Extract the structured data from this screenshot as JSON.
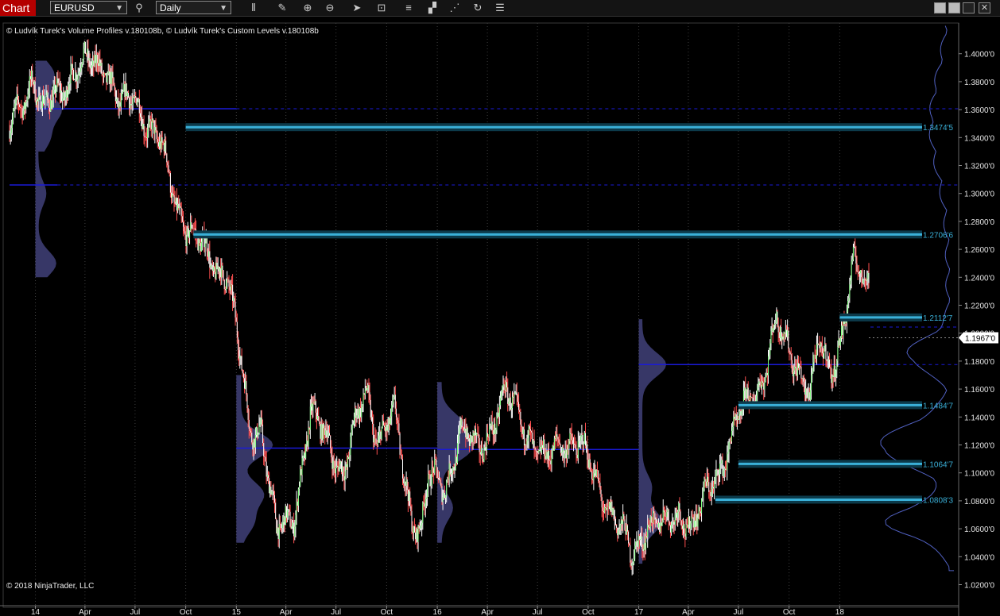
{
  "toolbar": {
    "tab_label": "Chart",
    "instrument": "EURUSD",
    "interval": "Daily"
  },
  "header": {
    "indicators_text": "© Ludvík Turek's Volume Profiles v.180108b, © Ludvík Turek's Custom Levels v.180108b"
  },
  "footer": {
    "copyright": "© 2018 NinjaTrader, LLC"
  },
  "colors": {
    "background": "#000000",
    "level_line": "#3ab0d8",
    "poc_line": "#1a1ad8",
    "profile_fill": "#4a4a8a",
    "current_price_box": "#ffffff"
  },
  "chart_data": {
    "type": "candlestick",
    "instrument": "EURUSD",
    "interval": "Daily",
    "ylim": [
      1.01,
      1.425
    ],
    "xlim": [
      "2013-11-15",
      "2018-03-05"
    ],
    "y_ticks": [
      "1.0200'0",
      "1.0400'0",
      "1.0600'0",
      "1.0800'0",
      "1.1000'0",
      "1.1200'0",
      "1.1400'0",
      "1.1600'0",
      "1.1800'0",
      "1.2000'0",
      "1.2200'0",
      "1.2400'0",
      "1.2600'0",
      "1.2800'0",
      "1.3000'0",
      "1.3200'0",
      "1.3400'0",
      "1.3600'0",
      "1.3800'0",
      "1.4000'0"
    ],
    "x_ticks": [
      {
        "label": "14",
        "date": "2014-01-01"
      },
      {
        "label": "Apr",
        "date": "2014-04-01"
      },
      {
        "label": "Jul",
        "date": "2014-07-01"
      },
      {
        "label": "Oct",
        "date": "2014-10-01"
      },
      {
        "label": "15",
        "date": "2015-01-01"
      },
      {
        "label": "Apr",
        "date": "2015-04-01"
      },
      {
        "label": "Jul",
        "date": "2015-07-01"
      },
      {
        "label": "Oct",
        "date": "2015-10-01"
      },
      {
        "label": "16",
        "date": "2016-01-01"
      },
      {
        "label": "Apr",
        "date": "2016-04-01"
      },
      {
        "label": "Jul",
        "date": "2016-07-01"
      },
      {
        "label": "Oct",
        "date": "2016-10-01"
      },
      {
        "label": "17",
        "date": "2017-01-01"
      },
      {
        "label": "Apr",
        "date": "2017-04-01"
      },
      {
        "label": "Jul",
        "date": "2017-07-01"
      },
      {
        "label": "Oct",
        "date": "2017-10-01"
      },
      {
        "label": "18",
        "date": "2018-01-01"
      }
    ],
    "price_path": [
      [
        "2013-11-15",
        1.345
      ],
      [
        "2013-12-27",
        1.385
      ],
      [
        "2014-01-15",
        1.357
      ],
      [
        "2014-03-15",
        1.39
      ],
      [
        "2014-05-08",
        1.393
      ],
      [
        "2014-06-05",
        1.36
      ],
      [
        "2014-07-01",
        1.368
      ],
      [
        "2014-08-15",
        1.335
      ],
      [
        "2014-09-15",
        1.29
      ],
      [
        "2014-10-15",
        1.27
      ],
      [
        "2014-11-15",
        1.25
      ],
      [
        "2014-12-15",
        1.245
      ],
      [
        "2015-01-05",
        1.19
      ],
      [
        "2015-01-25",
        1.13
      ],
      [
        "2015-02-15",
        1.135
      ],
      [
        "2015-03-15",
        1.055
      ],
      [
        "2015-04-15",
        1.07
      ],
      [
        "2015-05-15",
        1.14
      ],
      [
        "2015-06-15",
        1.125
      ],
      [
        "2015-07-15",
        1.1
      ],
      [
        "2015-08-24",
        1.16
      ],
      [
        "2015-09-15",
        1.125
      ],
      [
        "2015-10-15",
        1.14
      ],
      [
        "2015-11-15",
        1.07
      ],
      [
        "2015-12-03",
        1.06
      ],
      [
        "2015-12-15",
        1.095
      ],
      [
        "2016-01-15",
        1.09
      ],
      [
        "2016-02-11",
        1.13
      ],
      [
        "2016-03-15",
        1.115
      ],
      [
        "2016-05-03",
        1.155
      ],
      [
        "2016-06-15",
        1.13
      ],
      [
        "2016-07-15",
        1.105
      ],
      [
        "2016-08-15",
        1.125
      ],
      [
        "2016-09-15",
        1.12
      ],
      [
        "2016-10-15",
        1.095
      ],
      [
        "2016-11-15",
        1.07
      ],
      [
        "2016-12-20",
        1.04
      ],
      [
        "2017-01-15",
        1.065
      ],
      [
        "2017-02-15",
        1.06
      ],
      [
        "2017-03-15",
        1.075
      ],
      [
        "2017-04-10",
        1.06
      ],
      [
        "2017-05-15",
        1.095
      ],
      [
        "2017-06-15",
        1.12
      ],
      [
        "2017-07-15",
        1.15
      ],
      [
        "2017-08-15",
        1.17
      ],
      [
        "2017-09-08",
        1.205
      ],
      [
        "2017-10-15",
        1.18
      ],
      [
        "2017-11-07",
        1.155
      ],
      [
        "2017-11-25",
        1.19
      ],
      [
        "2017-12-15",
        1.175
      ],
      [
        "2018-01-05",
        1.2
      ],
      [
        "2018-01-25",
        1.245
      ],
      [
        "2018-02-15",
        1.24
      ],
      [
        "2018-03-05",
        1.232
      ]
    ],
    "volume_profiles": [
      {
        "period": "2014",
        "poc": 1.3606
      },
      {
        "period": "2015",
        "poc": 1.1177
      },
      {
        "period": "2016",
        "poc": 1.1167
      },
      {
        "period": "2017",
        "poc": 1.1775
      }
    ],
    "custom_levels": [
      {
        "value": 1.34745,
        "label": "1.3474'5",
        "from": "2014-10-01"
      },
      {
        "value": 1.27066,
        "label": "1.2706'6",
        "from": "2014-10-15"
      },
      {
        "value": 1.21127,
        "label": "1.2112'7",
        "from": "2018-01-01"
      },
      {
        "value": 1.14847,
        "label": "1.1484'7",
        "from": "2017-07-01"
      },
      {
        "value": 1.10647,
        "label": "1.1064'7",
        "from": "2017-07-01"
      },
      {
        "value": 1.08083,
        "label": "1.0808'3",
        "from": "2017-05-20"
      }
    ],
    "extra_dashed_levels": [
      1.3606,
      1.3061,
      1.2044,
      1.1775
    ],
    "current_price": {
      "value": 1.1967,
      "label": "1.1967'0"
    }
  }
}
